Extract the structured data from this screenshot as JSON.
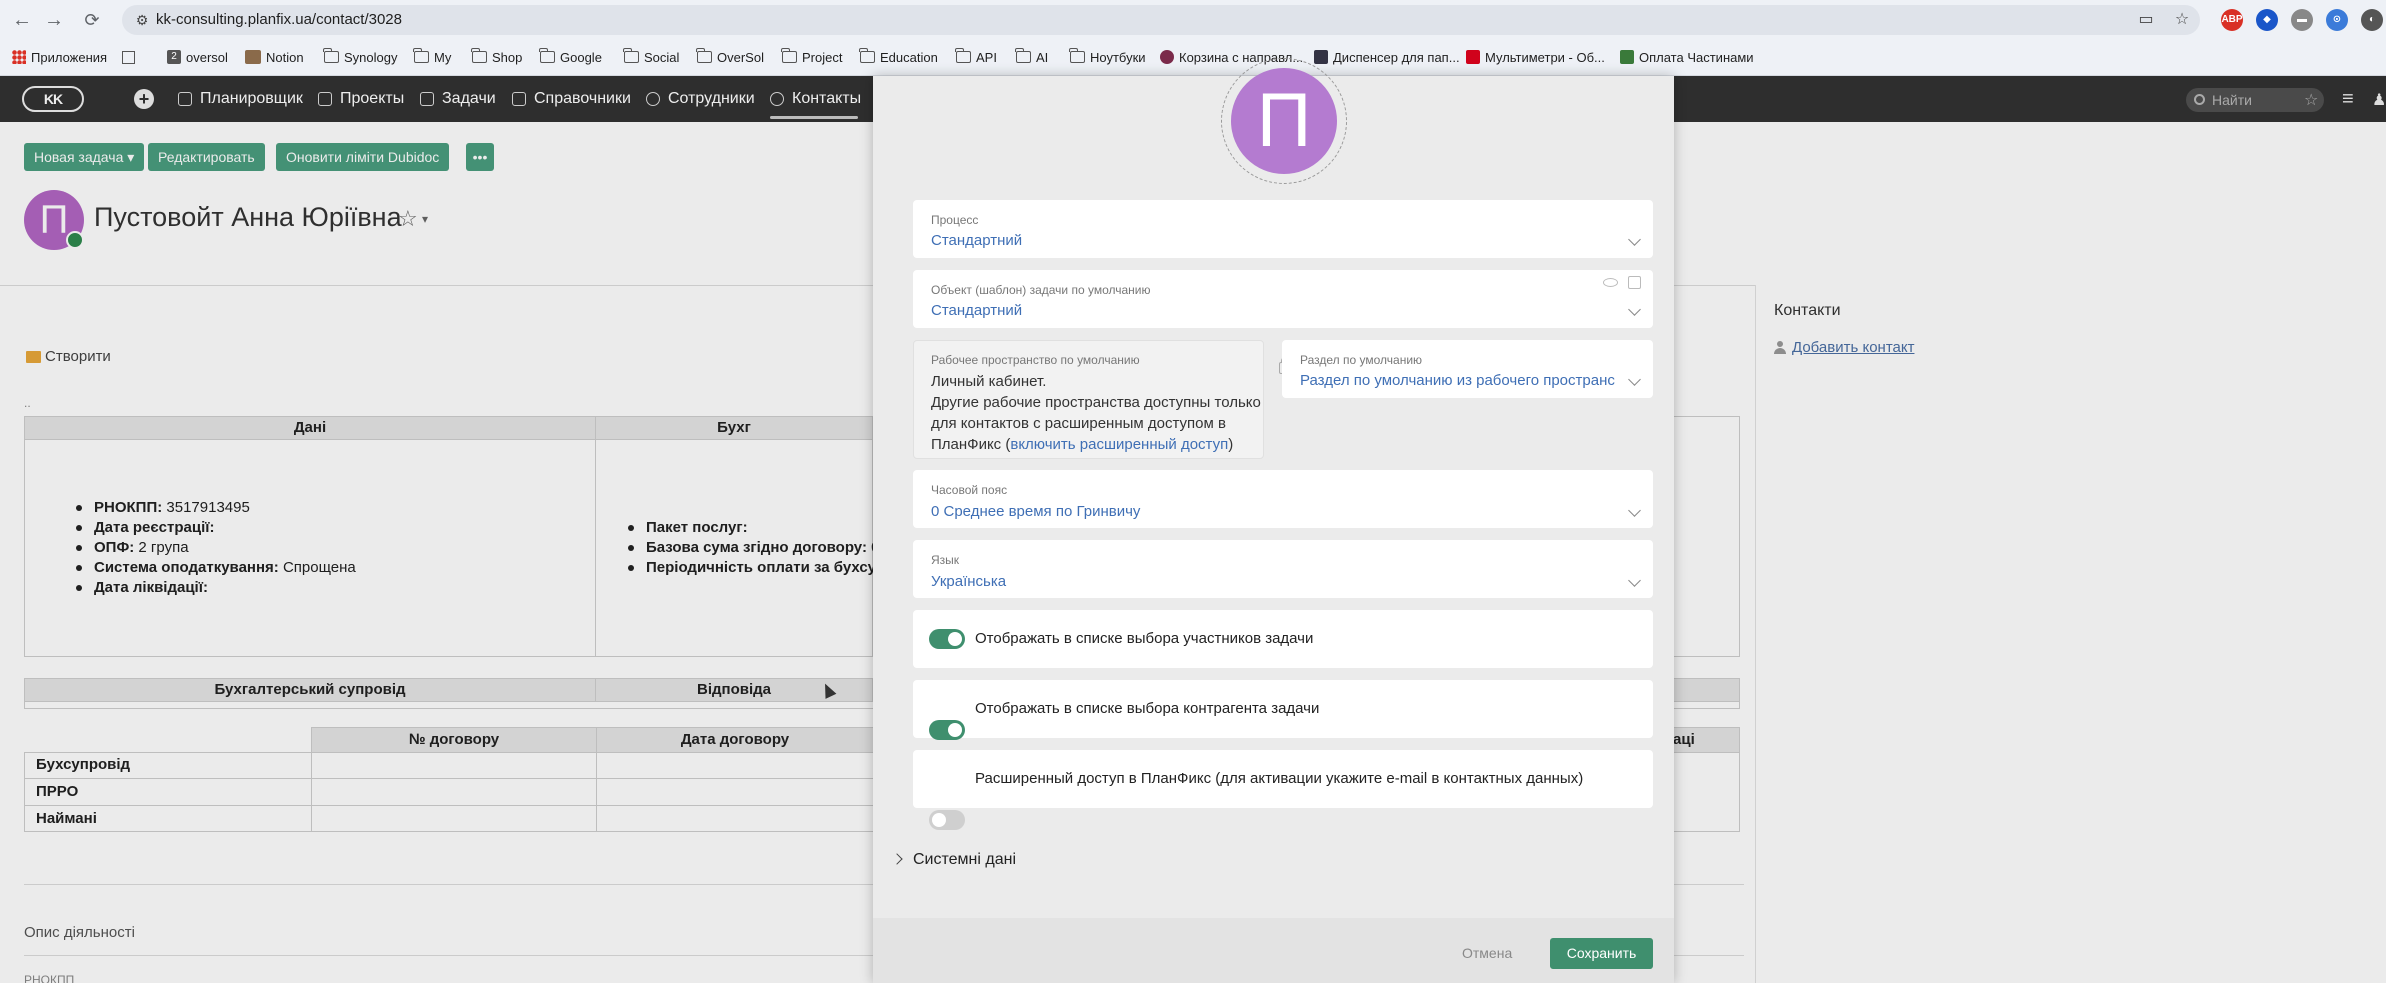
{
  "browser": {
    "url": "kk-consulting.planfix.ua/contact/3028",
    "bookmarks": [
      "Приложения",
      "oversol",
      "Notion",
      "Synology",
      "My",
      "Shop",
      "Google",
      "Social",
      "OverSol",
      "Project",
      "Education",
      "API",
      "AI",
      "Ноутбуки",
      "Корзина с направл...",
      "Диспенсер для пап...",
      "Мультиметри - Об...",
      "Оплата Частинами"
    ],
    "bookmark_badge": "2"
  },
  "app": {
    "logo": "KK",
    "menu": [
      "Планировщик",
      "Проекты",
      "Задачи",
      "Справочники",
      "Сотрудники",
      "Контакты"
    ],
    "search_placeholder": "Найти"
  },
  "page": {
    "buttons": [
      "Новая задача ▾",
      "Редактировать",
      "Оновити ліміти Dubidoc",
      "•••"
    ],
    "avatar_letter": "П",
    "contact_name": "Пустовойт Анна Юріївна",
    "create_link": "Створити",
    "table1": {
      "headers": [
        "Дані",
        "Бухг"
      ],
      "col1": [
        {
          "k": "РНОКПП:",
          "v": " 3517913495"
        },
        {
          "k": "Дата реєстрації:",
          "v": ""
        },
        {
          "k": "ОПФ:",
          "v": " 2 група"
        },
        {
          "k": "Система оподаткування:",
          "v": " Спрощена"
        },
        {
          "k": "Дата ліквідації:",
          "v": ""
        }
      ],
      "col2": [
        {
          "k": "Пакет послуг:",
          "v": ""
        },
        {
          "k": "Базова сума згідно договору:",
          "v": " 0"
        },
        {
          "k": "Періодичність оплати за бухсу",
          "v": ""
        }
      ]
    },
    "table2": {
      "headers": [
        "Бухгалтерський супровід",
        "Відповіда"
      ],
      "sub_headers": [
        "№ договору",
        "Дата договору",
        "аці"
      ],
      "rows": [
        "Бухсупровід",
        "ПРРО",
        "Наймані"
      ]
    },
    "description_label": "Опис діяльності",
    "rnokpp_partial": "РНОКПП",
    "right_panel": {
      "title": "Контакти",
      "add_contact": "Добавить контакт"
    }
  },
  "modal": {
    "avatar_letter": "П",
    "process": {
      "label": "Процесс",
      "value": "Стандартний"
    },
    "task_template": {
      "label": "Объект (шаблон) задачи по умолчанию",
      "value": "Стандартний"
    },
    "workspace": {
      "label": "Рабочее пространство по умолчанию",
      "line1": "Личный кабинет.",
      "line2": "Другие рабочие пространства доступны только",
      "line3": "для контактов с расширенным доступом в",
      "line4_prefix": "ПланФикс (",
      "line4_link": "включить расширенный доступ",
      "line4_suffix": ")"
    },
    "section": {
      "label": "Раздел по умолчанию",
      "value": "Раздел по умолчанию из рабочего пространс"
    },
    "timezone": {
      "label": "Часовой пояс",
      "value": "0 Среднее время по Гринвичу"
    },
    "language": {
      "label": "Язык",
      "value": "Українська"
    },
    "toggles": [
      {
        "label": "Отображать в списке выбора участников задачи",
        "on": true
      },
      {
        "label": "Отображать в списке выбора контрагента задачи",
        "on": true
      },
      {
        "label": "Расширенный доступ в ПланФикс (для активации укажите e-mail в контактных данных)",
        "on": false
      }
    ],
    "system_data": "Системні дані",
    "cancel": "Отмена",
    "save": "Сохранить"
  },
  "colors": {
    "accent": "#3f8f6e",
    "link": "#3f6fb5",
    "avatar": "#b47bd0",
    "header": "#2e2e2e"
  }
}
